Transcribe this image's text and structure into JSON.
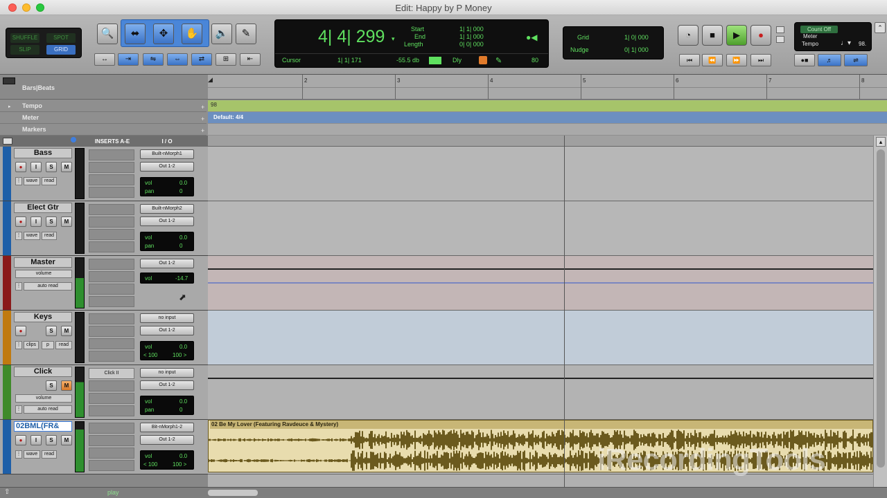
{
  "window": {
    "title": "Edit: Happy by P Money"
  },
  "modes": {
    "shuffle": "SHUFFLE",
    "spot": "SPOT",
    "slip": "SLIP",
    "grid": "GRID"
  },
  "counter": {
    "main": "4| 4| 299",
    "start_label": "Start",
    "end_label": "End",
    "length_label": "Length",
    "start": "1| 1| 000",
    "end": "1| 1| 000",
    "length": "0| 0| 000",
    "cursor_label": "Cursor",
    "cursor": "1| 1| 171",
    "db": "-55.5 db",
    "dly": "Dly",
    "num": "80"
  },
  "grid": {
    "grid_label": "Grid",
    "grid_value": "1| 0| 000",
    "nudge_label": "Nudge",
    "nudge_value": "0| 1| 000"
  },
  "countoff": {
    "count_off": "Count Off",
    "meter": "Meter",
    "tempo": "Tempo",
    "tempo_val": "98."
  },
  "rulers": {
    "bars_beats": "Bars|Beats",
    "tempo": "Tempo",
    "meter": "Meter",
    "markers": "Markers",
    "bar_numbers": [
      "2",
      "3",
      "4",
      "5",
      "6",
      "7",
      "8"
    ],
    "tempo_value": "98",
    "meter_value": "Default: 4/4"
  },
  "headers": {
    "inserts": "INSERTS A-E",
    "io": "I / O"
  },
  "tracks": [
    {
      "name": "Bass",
      "color": "#1e5fa8",
      "mode1": "wave",
      "mode2": "read",
      "io1": "Built-nMorph1",
      "io2": "Out 1-2",
      "vol_label": "vol",
      "vol": "0.0",
      "pan_label": "pan",
      "pan": "0"
    },
    {
      "name": "Elect Gtr",
      "color": "#1e5fa8",
      "mode1": "wave",
      "mode2": "read",
      "io1": "Built-nMorph2",
      "io2": "Out 1-2",
      "vol_label": "vol",
      "vol": "0.0",
      "pan_label": "pan",
      "pan": "0"
    },
    {
      "name": "Master",
      "color": "#8a1a1a",
      "mode1": "volume",
      "mode2": "auto read",
      "io1": "Out 1-2",
      "vol_label": "vol",
      "vol": "-14.7"
    },
    {
      "name": "Keys",
      "color": "#c07a10",
      "mode1": "clips",
      "mode2": "read",
      "mode3": "p",
      "io1": "no input",
      "io2": "Out 1-2",
      "vol_label": "vol",
      "vol": "0.0",
      "pan_l": "< 100",
      "pan_r": "100 >"
    },
    {
      "name": "Click",
      "color": "#3f8a2a",
      "mode1": "volume",
      "mode2": "auto read",
      "insert": "Click II",
      "io1": "no input",
      "io2": "Out 1-2",
      "vol_label": "vol",
      "vol": "0.0",
      "pan_label": "pan",
      "pan": "0"
    },
    {
      "name": "02BML(FR&",
      "color": "#1e5fa8",
      "mode1": "wave",
      "mode2": "read",
      "io1": "Bit-nMorph1-2",
      "io2": "Out 1-2",
      "vol_label": "vol",
      "vol": "0.0",
      "pan_l": "< 100",
      "pan_r": "100 >"
    }
  ],
  "clip": {
    "name": "02 Be My Lover (Featuring Ravdeuce & Mystery)"
  },
  "status": {
    "play": "play"
  },
  "watermark": "iRecordingTools",
  "colors": {
    "counter_green": "#5fe05f",
    "tempo_ruler": "#a6c46a",
    "meter_ruler": "#6c8fc0",
    "clip_waveform": "#6b5a1e",
    "clip_bg": "#e8dcae"
  }
}
